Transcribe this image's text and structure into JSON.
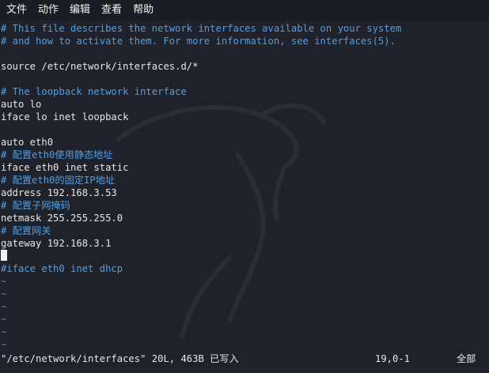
{
  "menubar": {
    "items": [
      "文件",
      "动作",
      "编辑",
      "查看",
      "帮助"
    ]
  },
  "editor": {
    "lines": [
      {
        "text": "# This file describes the network interfaces available on your system",
        "kind": "comment"
      },
      {
        "text": "# and how to activate them. For more information, see interfaces(5).",
        "kind": "comment"
      },
      {
        "text": "",
        "kind": "text"
      },
      {
        "text": "source /etc/network/interfaces.d/*",
        "kind": "text"
      },
      {
        "text": "",
        "kind": "text"
      },
      {
        "text": "# The loopback network interface",
        "kind": "comment"
      },
      {
        "text": "auto lo",
        "kind": "text"
      },
      {
        "text": "iface lo inet loopback",
        "kind": "text"
      },
      {
        "text": "",
        "kind": "text"
      },
      {
        "text": "auto eth0",
        "kind": "text"
      },
      {
        "text": "# 配置eth0使用静态地址",
        "kind": "comment"
      },
      {
        "text": "iface eth0 inet static",
        "kind": "text"
      },
      {
        "text": "# 配置eth0的固定IP地址",
        "kind": "comment"
      },
      {
        "text": "address 192.168.3.53",
        "kind": "text"
      },
      {
        "text": "# 配置子网掩码",
        "kind": "comment"
      },
      {
        "text": "netmask 255.255.255.0",
        "kind": "text"
      },
      {
        "text": "# 配置网关",
        "kind": "comment"
      },
      {
        "text": "gateway 192.168.3.1",
        "kind": "text"
      },
      {
        "text": "",
        "kind": "cursor"
      },
      {
        "text": "#iface eth0 inet dhcp",
        "kind": "comment"
      },
      {
        "text": "~",
        "kind": "tilde"
      },
      {
        "text": "~",
        "kind": "tilde"
      },
      {
        "text": "~",
        "kind": "tilde"
      },
      {
        "text": "~",
        "kind": "tilde"
      },
      {
        "text": "~",
        "kind": "tilde"
      },
      {
        "text": "~",
        "kind": "tilde"
      }
    ]
  },
  "statusbar": {
    "message": "\"/etc/network/interfaces\" 20L, 463B 已写入",
    "position": "19,0-1",
    "percent": "全部"
  },
  "colors": {
    "background": "#20222b",
    "comment": "#4f9fe3",
    "text": "#e6e6e8",
    "tilde": "#4a7bd0"
  },
  "icons": {
    "watermark": "kali-dragon-icon"
  }
}
